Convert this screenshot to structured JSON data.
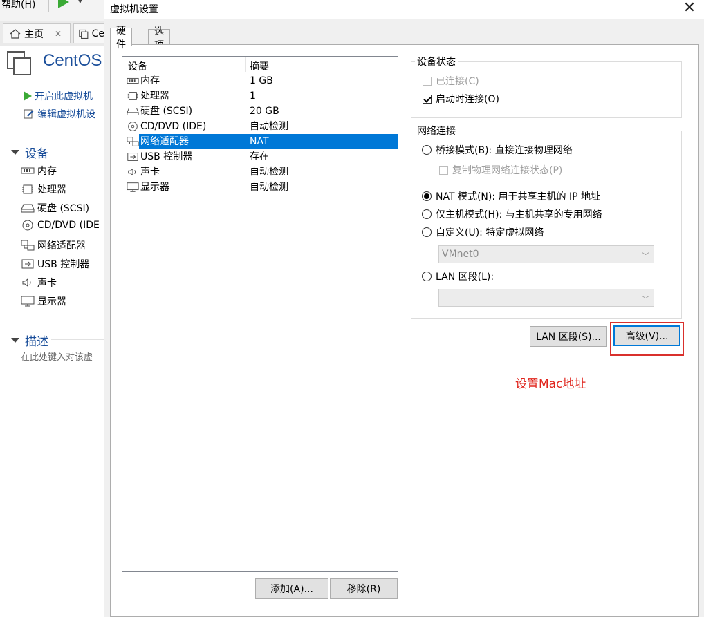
{
  "background_app": {
    "menu_help": "帮助(H)",
    "tabs": [
      {
        "label": "主页"
      },
      {
        "label": "Ce"
      }
    ],
    "vm_title": "CentOS",
    "actions": [
      {
        "label": "开启此虚拟机"
      },
      {
        "label": "编辑虚拟机设"
      }
    ],
    "devices_header": "设备",
    "devices": [
      {
        "label": "内存"
      },
      {
        "label": "处理器"
      },
      {
        "label": "硬盘 (SCSI)"
      },
      {
        "label": "CD/DVD (IDE"
      },
      {
        "label": "网络适配器"
      },
      {
        "label": "USB 控制器"
      },
      {
        "label": "声卡"
      },
      {
        "label": "显示器"
      }
    ],
    "description_header": "描述",
    "description_placeholder": "在此处键入对该虚"
  },
  "dialog": {
    "title": "虚拟机设置",
    "close_glyph": "✕",
    "tabs": [
      {
        "label": "硬件"
      },
      {
        "label": "选项"
      }
    ],
    "device_list": {
      "columns": [
        "设备",
        "摘要"
      ],
      "rows": [
        {
          "icon": "memory-icon",
          "name": "内存",
          "summary": "1 GB"
        },
        {
          "icon": "processor-icon",
          "name": "处理器",
          "summary": "1"
        },
        {
          "icon": "hard-disk-icon",
          "name": "硬盘 (SCSI)",
          "summary": "20 GB"
        },
        {
          "icon": "cd-dvd-icon",
          "name": "CD/DVD (IDE)",
          "summary": "自动检测"
        },
        {
          "icon": "network-adapter-icon",
          "name": "网络适配器",
          "summary": "NAT",
          "selected": true
        },
        {
          "icon": "usb-icon",
          "name": "USB 控制器",
          "summary": "存在"
        },
        {
          "icon": "sound-icon",
          "name": "声卡",
          "summary": "自动检测"
        },
        {
          "icon": "display-icon",
          "name": "显示器",
          "summary": "自动检测"
        }
      ]
    },
    "add_button": "添加(A)...",
    "remove_button": "移除(R)",
    "device_status": {
      "label": "设备状态",
      "connected": {
        "label": "已连接(C)",
        "checked": false,
        "enabled": false
      },
      "connect_at_power_on": {
        "label": "启动时连接(O)",
        "checked": true,
        "enabled": true
      }
    },
    "network_connection": {
      "label": "网络连接",
      "bridged": {
        "label": "桥接模式(B): 直接连接物理网络",
        "checked": false
      },
      "replicate": {
        "label": "复制物理网络连接状态(P)",
        "checked": false,
        "enabled": false
      },
      "nat": {
        "label": "NAT 模式(N): 用于共享主机的 IP 地址",
        "checked": true
      },
      "host_only": {
        "label": "仅主机模式(H): 与主机共享的专用网络",
        "checked": false
      },
      "custom": {
        "label": "自定义(U): 特定虚拟网络",
        "checked": false
      },
      "custom_select_value": "VMnet0",
      "lan_segment": {
        "label": "LAN 区段(L):",
        "checked": false
      },
      "lan_select_value": ""
    },
    "lan_segments_button": "LAN 区段(S)...",
    "advanced_button": "高级(V)...",
    "annotation": "设置Mac地址"
  },
  "colors": {
    "selection": "#0078d7",
    "annotation": "#e0251d",
    "link": "#1a4e9a",
    "play": "#3aa935"
  }
}
